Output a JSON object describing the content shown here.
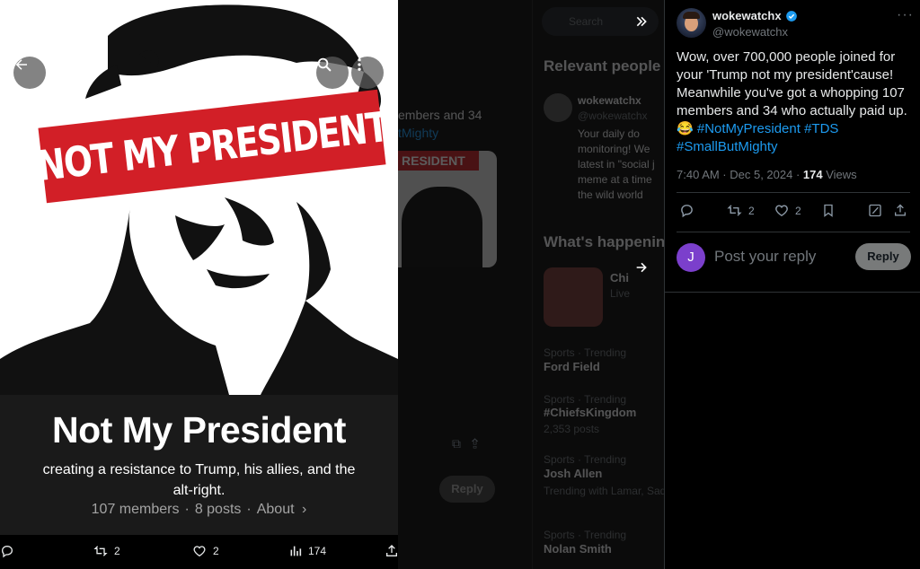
{
  "background": {
    "tweet_text_line1": "embers and 34",
    "tweet_text_line2": "tMighty",
    "image_banner": "RESIDENT",
    "reply_label": "Reply",
    "search_placeholder": "Search",
    "relevant_people": {
      "heading": "Relevant people",
      "name": "wokewatchx",
      "handle": "@wokewatchx",
      "bio": [
        "Your daily do",
        "monitoring! We",
        "latest in \"social j",
        "meme at a time",
        "the wild world"
      ]
    },
    "whats_happening": {
      "heading": "What's happenin",
      "news_title": "Chi",
      "news_sub": "Live",
      "trends": [
        {
          "context": "Sports · Trending",
          "name": "Ford Field",
          "posts": ""
        },
        {
          "context": "Sports · Trending",
          "name": "#ChiefsKingdom",
          "posts": "2,353 posts"
        },
        {
          "context": "Sports · Trending",
          "name": "Josh Allen",
          "posts": "Trending with Lamar, Saqu"
        },
        {
          "context": "Sports · Trending",
          "name": "Nolan Smith",
          "posts": ""
        }
      ]
    }
  },
  "media": {
    "banner_text": "NOT MY PRESIDENT",
    "caption_title": "Not My President",
    "caption_desc": "creating a resistance to Trump, his allies, and the alt-right.",
    "members": "107 members",
    "posts": "8 posts",
    "about": "About",
    "bottom_actions": {
      "reposts": "2",
      "likes": "2",
      "views": "174"
    }
  },
  "post": {
    "display_name": "wokewatchx",
    "handle": "@wokewatchx",
    "text": "Wow, over 700,000 people joined for your 'Trump not my president'cause! Meanwhile you've got a whopping 107 members and 34 who actually paid up. 😂",
    "hashtags": [
      "#NotMyPresident",
      "#TDS",
      "#SmallButMighty"
    ],
    "time": "7:40 AM · Dec 5, 2024 · ",
    "views_count": "174",
    "views_label": " Views",
    "reposts": "2",
    "likes": "2",
    "reply_avatar_letter": "J",
    "reply_placeholder": "Post your reply",
    "reply_button": "Reply"
  },
  "colors": {
    "accent": "#1d9bf0",
    "banner_red": "#d21f27",
    "reply_avatar": "#7b3fcc",
    "verified": "#1d9bf0"
  }
}
